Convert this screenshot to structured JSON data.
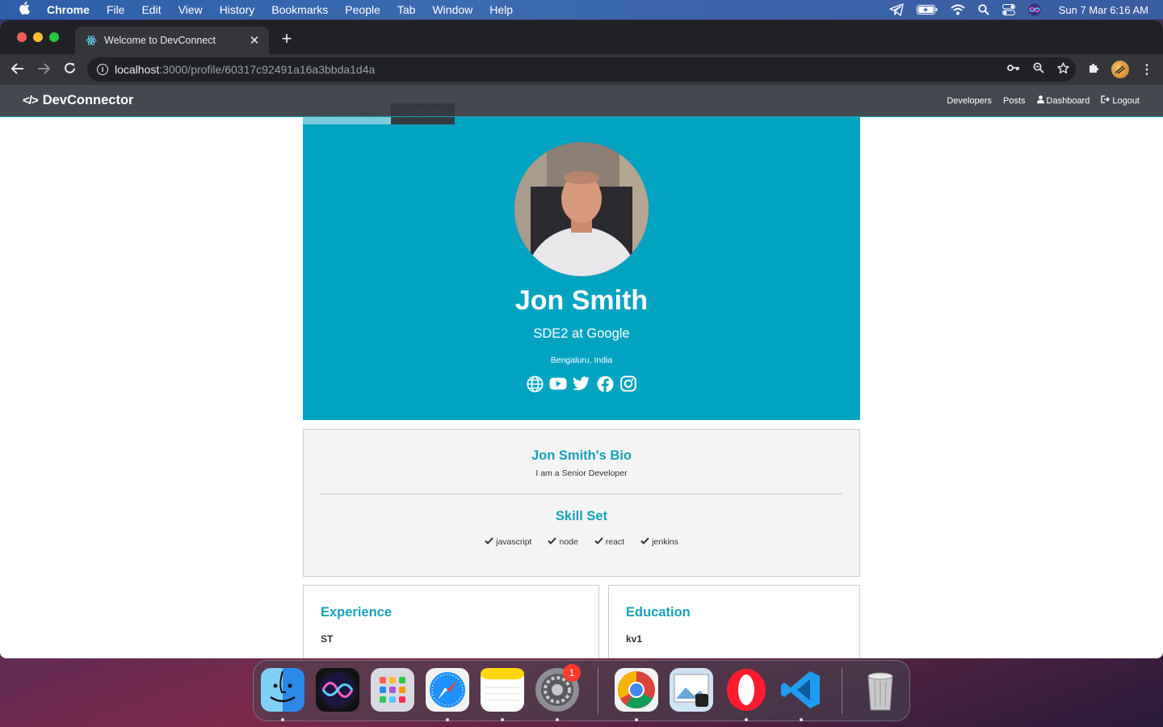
{
  "menubar": {
    "app_name": "Chrome",
    "items": [
      "File",
      "Edit",
      "View",
      "History",
      "Bookmarks",
      "People",
      "Tab",
      "Window",
      "Help"
    ],
    "clock": "Sun 7 Mar  6:16 AM",
    "status_icons": [
      "telegram-icon",
      "battery-icon",
      "wifi-icon",
      "spotlight-icon",
      "control-center-icon",
      "siri-icon"
    ]
  },
  "browser": {
    "tab_title": "Welcome to DevConnect",
    "url_host": "localhost",
    "url_path": ":3000/profile/60317c92491a16a3bbda1d4a"
  },
  "app": {
    "brand": "DevConnector",
    "nav": {
      "developers": "Developers",
      "posts": "Posts",
      "dashboard": "Dashboard",
      "logout": "Logout"
    },
    "back_button": "Back To Profiles",
    "edit_button": "Edit Profile"
  },
  "profile": {
    "name": "Jon Smith",
    "status": "SDE2 at Google",
    "location": "Bengaluru, India",
    "social": [
      "globe-icon",
      "youtube-icon",
      "twitter-icon",
      "facebook-icon",
      "instagram-icon"
    ],
    "bio_title": "Jon Smith's Bio",
    "bio": "I am a Senior Developer",
    "skills_title": "Skill Set",
    "skills": [
      "javascript",
      "node",
      "react",
      "jenkins"
    ],
    "experience_title": "Experience",
    "experience_first": "ST",
    "education_title": "Education",
    "education_first": "kv1"
  },
  "dock": {
    "apps": [
      "Finder",
      "Siri",
      "Launchpad",
      "Safari",
      "Notes",
      "System Preferences",
      "Chrome",
      "Preview",
      "Opera",
      "Visual Studio Code",
      "Trash"
    ],
    "system_preferences_badge": "1"
  },
  "colors": {
    "accent": "#17a2b8",
    "profile_bg": "#00a4c1",
    "navbar": "#343a40"
  }
}
